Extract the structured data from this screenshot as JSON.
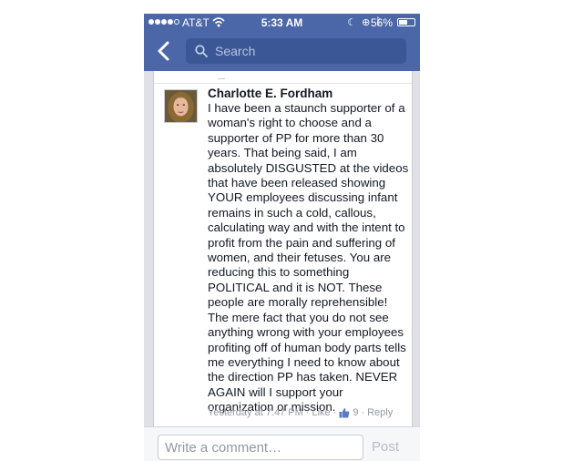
{
  "status_bar": {
    "carrier": "AT&T",
    "time": "5:33 AM",
    "battery_percent": "56%",
    "battery_level": 0.56,
    "signal_bars": 4
  },
  "nav": {
    "search_placeholder": "Search"
  },
  "comment": {
    "author": "Charlotte E. Fordham",
    "text": "I have been a staunch supporter of a woman's right to choose and a supporter of PP for more than 30 years. That being said, I am absolutely DISGUSTED at the videos that have been released showing YOUR employees discussing infant remains in such a cold, callous, calculating way and with the intent to profit from the pain and suffering of women, and their fetuses. You are reducing this to something POLITICAL and it is NOT. These people are morally reprehensible! The mere fact that you do not see anything wrong with your employees profiting off of human body parts tells me everything I need to know about the direction PP has taken. NEVER AGAIN will I support your organization or mission.",
    "timestamp": "Yesterday at 7:47 PM",
    "separator": "·",
    "like_label": "Like",
    "like_count": "9",
    "reply_label": "Reply"
  },
  "composer": {
    "placeholder": "Write a comment…",
    "post_label": "Post"
  },
  "colors": {
    "nav_blue": "#4b67a8",
    "search_bg": "#3b5796",
    "meta_gray": "#9197a3",
    "link_blue": "#4b67a8"
  }
}
